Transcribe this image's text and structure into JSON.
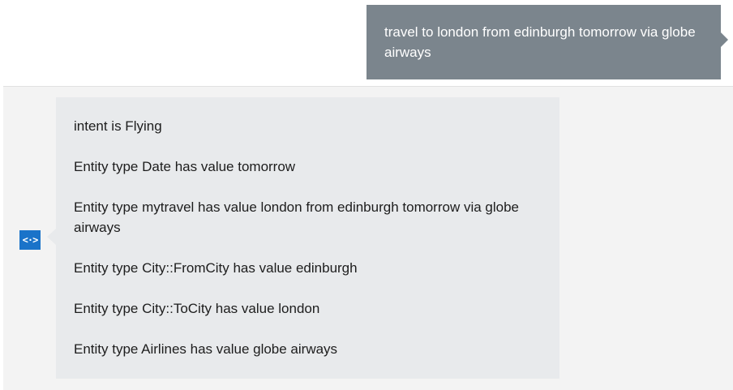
{
  "user_message": {
    "text": "travel to london from edinburgh tomorrow via globe airways"
  },
  "bot": {
    "avatar_icon": "code-bracket-icon",
    "avatar_glyph": "<·>",
    "avatar_color": "#1a73c9",
    "lines": [
      "intent is Flying",
      "Entity type Date has value tomorrow",
      "Entity type mytravel has value london from edinburgh tomorrow via globe airways",
      "Entity type City::FromCity has value edinburgh",
      "Entity type City::ToCity has value london",
      "Entity type Airlines has value globe airways"
    ]
  }
}
